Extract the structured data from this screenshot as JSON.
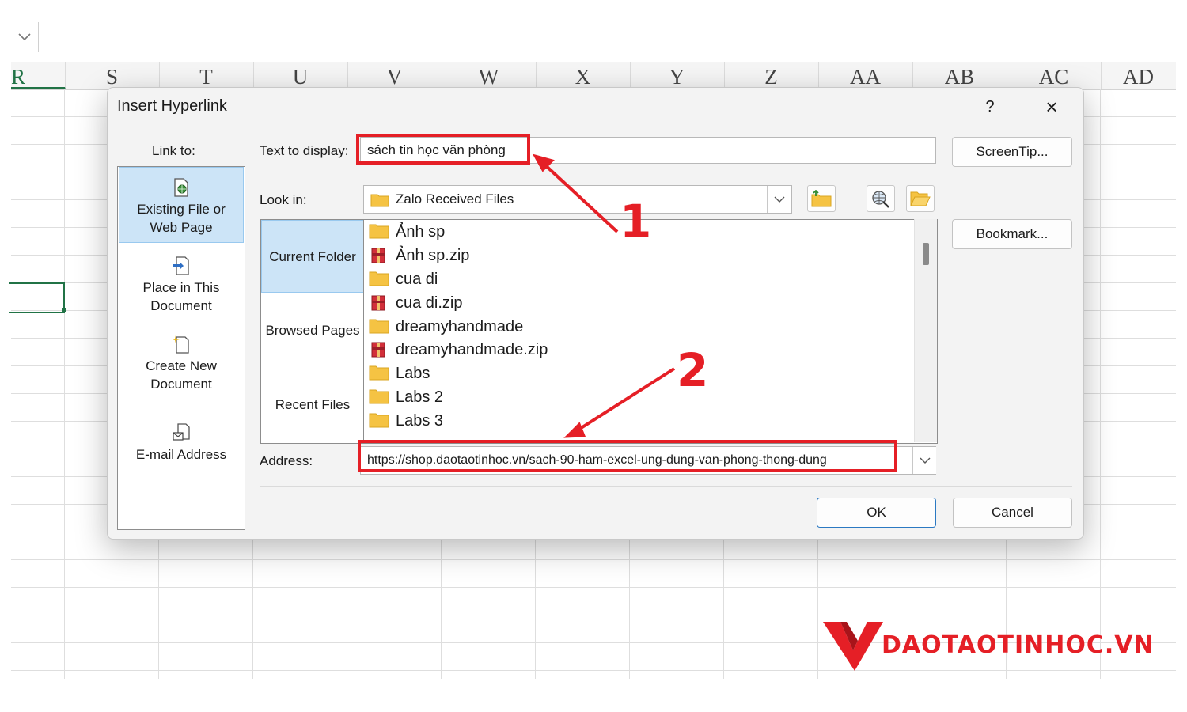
{
  "spreadsheet": {
    "columns": [
      "R",
      "S",
      "T",
      "U",
      "V",
      "W",
      "X",
      "Y",
      "Z",
      "AA",
      "AB",
      "AC",
      "AD"
    ],
    "active_column": "R"
  },
  "dialog": {
    "title": "Insert Hyperlink",
    "help_label": "?",
    "close_label": "×",
    "link_to_label": "Link to:",
    "link_to_items": [
      {
        "label_line1": "Existing File or",
        "label_line2": "Web Page",
        "icon": "existing-file-icon",
        "selected": true
      },
      {
        "label_line1": "Place in This",
        "label_line2": "Document",
        "icon": "place-in-document-icon",
        "selected": false
      },
      {
        "label_line1": "Create New",
        "label_line2": "Document",
        "icon": "create-new-document-icon",
        "selected": false
      },
      {
        "label_line1": "E-mail Address",
        "label_line2": "",
        "icon": "email-address-icon",
        "selected": false
      }
    ],
    "text_to_display_label": "Text to display:",
    "text_to_display_value": "sách tin học văn phòng",
    "screentip_label": "ScreenTip...",
    "look_in_label": "Look in:",
    "look_in_value": "Zalo Received Files",
    "bookmark_label": "Bookmark...",
    "lookin_tabs": [
      "Current Folder",
      "Browsed Pages",
      "Recent Files"
    ],
    "files": [
      {
        "name": "Ảnh sp",
        "type": "folder"
      },
      {
        "name": "Ảnh sp.zip",
        "type": "zip"
      },
      {
        "name": "cua di",
        "type": "folder"
      },
      {
        "name": "cua di.zip",
        "type": "zip"
      },
      {
        "name": "dreamyhandmade",
        "type": "folder"
      },
      {
        "name": "dreamyhandmade.zip",
        "type": "zip"
      },
      {
        "name": "Labs",
        "type": "folder"
      },
      {
        "name": "Labs 2",
        "type": "folder"
      },
      {
        "name": "Labs 3",
        "type": "folder"
      }
    ],
    "address_label": "Address:",
    "address_value": "https://shop.daotaotinhoc.vn/sach-90-ham-excel-ung-dung-van-phong-thong-dung",
    "ok_label": "OK",
    "cancel_label": "Cancel"
  },
  "annotations": {
    "callout_1": "1",
    "callout_2": "2",
    "color": "#e51f26"
  },
  "brand": {
    "text": "DAOTAOTINHOC.VN",
    "color": "#e51f26"
  }
}
